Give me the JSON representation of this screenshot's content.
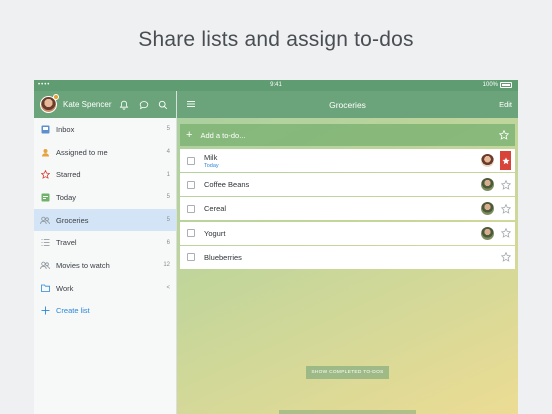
{
  "headline": "Share lists and assign to-dos",
  "status": {
    "signal": "•••• ",
    "time": "9:41",
    "battery": "100%"
  },
  "user": {
    "name": "Kate Spencer"
  },
  "sidebar": {
    "items": [
      {
        "label": "Inbox",
        "count": "5",
        "icon": "inbox-icon"
      },
      {
        "label": "Assigned to me",
        "count": "4",
        "icon": "person-icon"
      },
      {
        "label": "Starred",
        "count": "1",
        "icon": "star-icon"
      },
      {
        "label": "Today",
        "count": "5",
        "icon": "calendar-icon"
      },
      {
        "label": "Groceries",
        "count": "5",
        "icon": "shared-list-icon",
        "active": true
      },
      {
        "label": "Travel",
        "count": "6",
        "icon": "list-icon"
      },
      {
        "label": "Movies to watch",
        "count": "12",
        "icon": "shared-list-icon"
      },
      {
        "label": "Work",
        "count": "<",
        "icon": "folder-icon"
      }
    ],
    "create_label": "Create list"
  },
  "main": {
    "title": "Groceries",
    "edit_label": "Edit",
    "add_placeholder": "Add a to-do...",
    "todos": [
      {
        "title": "Milk",
        "due": "Today",
        "assignee": "kate",
        "starred": true
      },
      {
        "title": "Coffee Beans",
        "assignee": "other",
        "starred": false
      },
      {
        "title": "Cereal",
        "assignee": "other",
        "starred": false
      },
      {
        "title": "Yogurt",
        "assignee": "other",
        "starred": false
      },
      {
        "title": "Blueberries",
        "assignee": "",
        "starred": false
      }
    ],
    "show_completed_label": "SHOW COMPLETED TO-DOS"
  },
  "colors": {
    "accent_green": "#6ba47b",
    "link_blue": "#2b88d9",
    "star_red": "#d9443a",
    "active_blue": "#d3e4f6"
  }
}
